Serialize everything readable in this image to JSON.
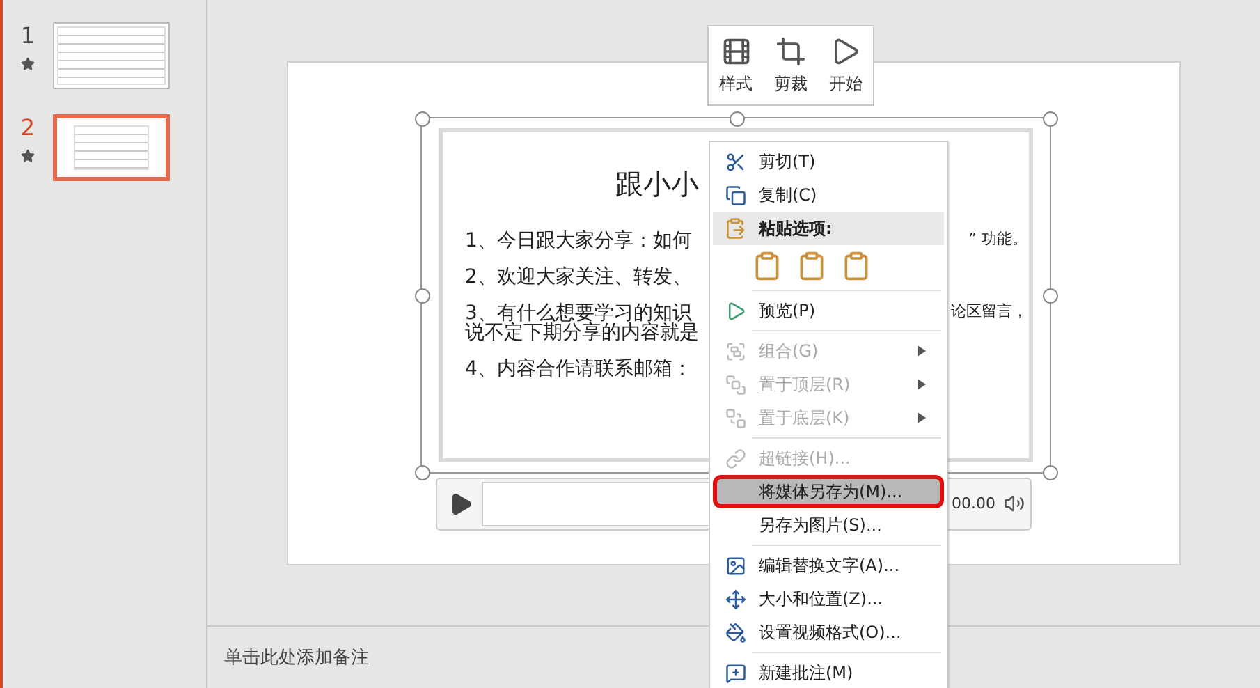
{
  "slides": [
    {
      "number": "1",
      "selected": false
    },
    {
      "number": "2",
      "selected": true
    }
  ],
  "mini_toolbar": [
    {
      "kind": "style",
      "label": "样式"
    },
    {
      "kind": "trim",
      "label": "剪裁"
    },
    {
      "kind": "start",
      "label": "开始"
    }
  ],
  "slide": {
    "title": "跟小小",
    "lines": [
      {
        "kind": "item",
        "text": "1、今日跟大家分享：如何",
        "right": "” 功能。"
      },
      {
        "kind": "item",
        "text": "2、欢迎大家关注、转发、"
      },
      {
        "kind": "item",
        "text": "3、有什么想要学习的知识",
        "right": "论区留言，"
      },
      {
        "kind": "continuation",
        "text": "说不定下期分享的内容就是"
      },
      {
        "kind": "item",
        "text": "4、内容合作请联系邮箱："
      }
    ]
  },
  "player": {
    "time": "00.00"
  },
  "context_menu": {
    "items": [
      {
        "kind": "command",
        "label": "剪切(T)",
        "disabled": false,
        "submenu": false,
        "highlighted": false
      },
      {
        "kind": "command",
        "label": "复制(C)",
        "disabled": false,
        "submenu": false,
        "highlighted": false
      },
      {
        "kind": "header",
        "label": "粘贴选项:"
      },
      {
        "kind": "paste_options"
      },
      {
        "kind": "separator"
      },
      {
        "kind": "command",
        "label": "预览(P)",
        "disabled": false,
        "submenu": false,
        "highlighted": false
      },
      {
        "kind": "separator"
      },
      {
        "kind": "command",
        "label": "组合(G)",
        "disabled": true,
        "submenu": true,
        "highlighted": false
      },
      {
        "kind": "command",
        "label": "置于顶层(R)",
        "disabled": true,
        "submenu": true,
        "highlighted": false
      },
      {
        "kind": "command",
        "label": "置于底层(K)",
        "disabled": true,
        "submenu": true,
        "highlighted": false
      },
      {
        "kind": "separator"
      },
      {
        "kind": "command",
        "label": "超链接(H)...",
        "disabled": true,
        "submenu": false,
        "highlighted": false
      },
      {
        "kind": "command",
        "label": "将媒体另存为(M)...",
        "disabled": false,
        "submenu": false,
        "highlighted": true
      },
      {
        "kind": "command",
        "label": "另存为图片(S)...",
        "disabled": false,
        "submenu": false,
        "highlighted": false
      },
      {
        "kind": "separator"
      },
      {
        "kind": "command",
        "label": "编辑替换文字(A)...",
        "disabled": false,
        "submenu": false,
        "highlighted": false
      },
      {
        "kind": "command",
        "label": "大小和位置(Z)...",
        "disabled": false,
        "submenu": false,
        "highlighted": false
      },
      {
        "kind": "command",
        "label": "设置视频格式(O)...",
        "disabled": false,
        "submenu": false,
        "highlighted": false
      },
      {
        "kind": "separator"
      },
      {
        "kind": "command",
        "label": "新建批注(M)",
        "disabled": false,
        "submenu": false,
        "highlighted": false
      }
    ]
  },
  "notes": {
    "placeholder": "单击此处添加备注"
  }
}
